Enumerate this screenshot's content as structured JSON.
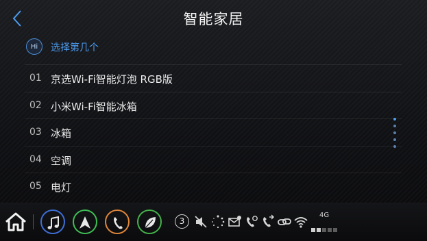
{
  "header": {
    "title": "智能家居",
    "back_icon": "chevron-left-icon"
  },
  "prompt": {
    "badge": "Hi",
    "text": "选择第几个"
  },
  "items": [
    {
      "num": "01",
      "label": "京选Wi-Fi智能灯泡 RGB版"
    },
    {
      "num": "02",
      "label": "小米Wi-Fi智能冰箱"
    },
    {
      "num": "03",
      "label": "冰箱"
    },
    {
      "num": "04",
      "label": "空调"
    },
    {
      "num": "05",
      "label": "电灯"
    }
  ],
  "dock": {
    "apps": [
      {
        "name": "music-icon",
        "color": "#3d6fd8"
      },
      {
        "name": "navigation-icon",
        "color": "#3fbf55"
      },
      {
        "name": "phone-icon",
        "color": "#e0873a"
      },
      {
        "name": "leaf-icon",
        "color": "#45b34a"
      }
    ],
    "notification_count": "3",
    "network": "4G"
  },
  "colors": {
    "accent": "#4c9cf0",
    "background": "#0f1013"
  }
}
